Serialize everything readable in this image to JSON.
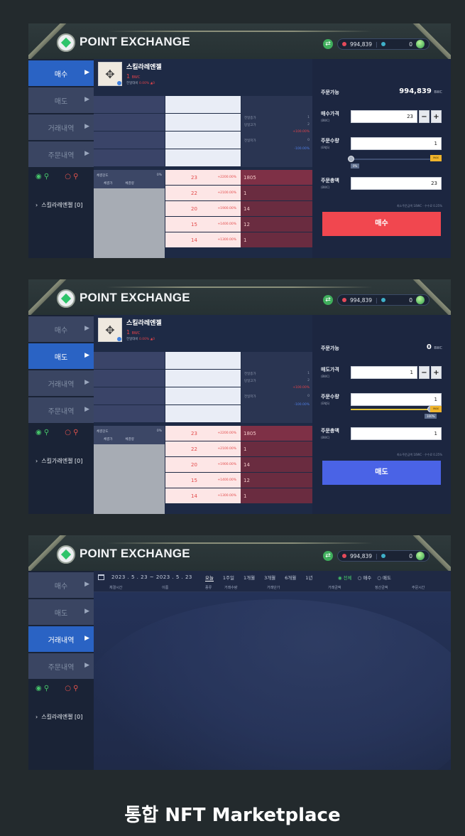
{
  "brand": "POINT EXCHANGE",
  "wallet": {
    "balance": "994,839",
    "coin": "0"
  },
  "menu": [
    "매수",
    "매도",
    "거래내역",
    "주문내역"
  ],
  "collection_label": "스킬라레엔젤 [0]",
  "collection_label_2": "스킬가래엔젤 [0]",
  "product": {
    "name": "스킬라레엔젤",
    "price": "1",
    "unit": "BWC",
    "rate_label": "전일대비",
    "rate_value": "0.00% ▲0"
  },
  "stats": {
    "high_label": "전일종가",
    "low_label": "당일고가",
    "v1": "1",
    "v2": "+100.00%",
    "today_label": "전일저가",
    "v3": "0",
    "v4": "-100.00%",
    "s2": "2",
    "s3": "0"
  },
  "info": {
    "label": "체결강도",
    "value": "0%",
    "tab1": "체결가",
    "tab2": "체결량"
  },
  "orderbook": [
    {
      "price": "23",
      "pct": "+2200.00%",
      "volume": "1805"
    },
    {
      "price": "22",
      "pct": "+2100.00%",
      "volume": "1"
    },
    {
      "price": "20",
      "pct": "+1900.00%",
      "volume": "14"
    },
    {
      "price": "15",
      "pct": "+1400.00%",
      "volume": "12"
    },
    {
      "price": "14",
      "pct": "+1300.00%",
      "volume": "1"
    }
  ],
  "buy_form": {
    "available_label": "주문가능",
    "available_value": "994,839",
    "available_unit": "BWC",
    "price_label": "매수가격",
    "price_unit": "(BWC)",
    "price_value": "23",
    "qty_label": "주문수량",
    "qty_unit": "(ENJS)",
    "qty_value": "1",
    "slider_pct": "0%",
    "slider_level": 0.0,
    "max_label": "MAX",
    "total_label": "주문총액",
    "total_unit": "(BWC)",
    "total_value": "23",
    "fee_text": "최소주문금액 10WC · 수수료 0.25%",
    "submit": "매수"
  },
  "sell_form": {
    "available_label": "주문가능",
    "available_value": "0",
    "available_unit": "BWC",
    "price_label": "매도가격",
    "price_unit": "(BWC)",
    "price_value": "1",
    "qty_label": "주문수량",
    "qty_unit": "(ENJS)",
    "qty_value": "1",
    "slider_pct": "100%",
    "slider_level": 1.0,
    "max_label": "MAX",
    "total_label": "주문총액",
    "total_unit": "(BWC)",
    "total_value": "1",
    "fee_text": "최소주문금액 10WC · 수수료 0.25%",
    "submit": "매도"
  },
  "history": {
    "date_range": "2023 . 5 . 23  ~  2023 . 5 . 23",
    "periods": [
      "오늘",
      "1주일",
      "1개월",
      "3개월",
      "6개월",
      "1년"
    ],
    "filters": [
      "전체",
      "매수",
      "매도"
    ],
    "columns": [
      "체결시간",
      "이름",
      "종류",
      "거래수량",
      "거래단가",
      "거래금액",
      "정산금액",
      "주문시간"
    ]
  },
  "caption": "통합 NFT Marketplace",
  "colors": {
    "buy": "#f1474f",
    "sell": "#4a63e6",
    "active_menu": "#2a63c4",
    "accent_green": "#46c46a"
  }
}
